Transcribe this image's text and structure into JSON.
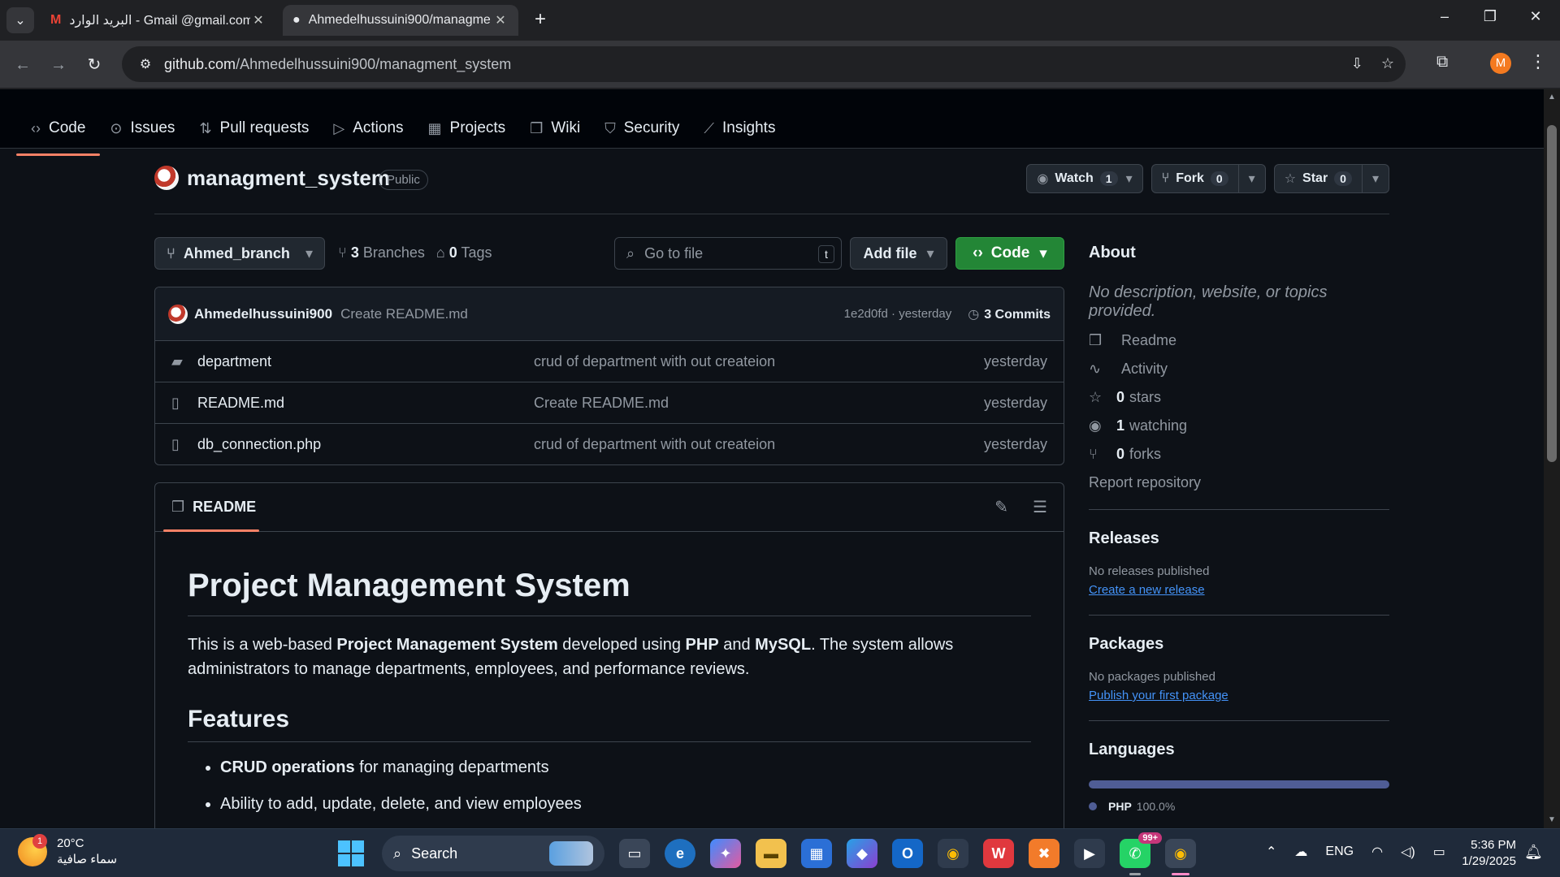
{
  "browser": {
    "tabs": [
      {
        "title": "البريد الوارد - Gmail @gmail.com",
        "active": false
      },
      {
        "title": "Ahmedelhussuini900/managme",
        "active": true
      }
    ],
    "url_host": "github.com",
    "url_path": "/Ahmedelhussuini900/managment_system",
    "profile_initial": "M"
  },
  "repo_nav": [
    {
      "label": "Code",
      "icon": "code-icon",
      "glyph": "‹›",
      "selected": true
    },
    {
      "label": "Issues",
      "icon": "issue-icon",
      "glyph": "⊙"
    },
    {
      "label": "Pull requests",
      "icon": "pull-request-icon",
      "glyph": "⇅"
    },
    {
      "label": "Actions",
      "icon": "play-icon",
      "glyph": "▷"
    },
    {
      "label": "Projects",
      "icon": "table-icon",
      "glyph": "▦"
    },
    {
      "label": "Wiki",
      "icon": "book-icon",
      "glyph": "❒"
    },
    {
      "label": "Security",
      "icon": "shield-icon",
      "glyph": "⛉"
    },
    {
      "label": "Insights",
      "icon": "graph-icon",
      "glyph": "⟋"
    }
  ],
  "repo": {
    "name": "managment_system",
    "visibility": "Public",
    "watch_label": "Watch",
    "watch_count": "1",
    "fork_label": "Fork",
    "fork_count": "0",
    "star_label": "Star",
    "star_count": "0"
  },
  "branch": {
    "current": "Ahmed_branch",
    "branches_count": "3",
    "branches_label": "Branches",
    "tags_count": "0",
    "tags_label": "Tags",
    "goto_placeholder": "Go to file",
    "goto_key": "t",
    "add_file": "Add file",
    "code_button": "Code"
  },
  "latest_commit": {
    "author": "Ahmedelhussuini900",
    "message": "Create README.md",
    "sha_time": "1e2d0fd · yesterday",
    "commits": "3 Commits"
  },
  "files": [
    {
      "type": "folder",
      "icon": "folder-icon",
      "name": "department",
      "message": "crud of department with out createion",
      "date": "yesterday"
    },
    {
      "type": "file",
      "icon": "file-icon",
      "name": "README.md",
      "message": "Create README.md",
      "date": "yesterday"
    },
    {
      "type": "file",
      "icon": "file-icon",
      "name": "db_connection.php",
      "message": "crud of department with out createion",
      "date": "yesterday"
    }
  ],
  "readme": {
    "tab_label": "README",
    "h1": "Project Management System",
    "para_parts": [
      "This is a web-based ",
      "Project Management System",
      " developed using ",
      "PHP",
      " and ",
      "MySQL",
      ". The system allows administrators to manage departments, employees, and performance reviews."
    ],
    "h2": "Features",
    "features": [
      {
        "bold": "CRUD operations",
        "rest": " for managing departments"
      },
      {
        "bold": "",
        "rest": "Ability to add, update, delete, and view employees"
      }
    ]
  },
  "about": {
    "heading": "About",
    "description": "No description, website, or topics provided.",
    "links": [
      {
        "icon": "book-icon",
        "glyph": "❒",
        "bold": "",
        "label": "Readme"
      },
      {
        "icon": "pulse-icon",
        "glyph": "∿",
        "bold": "",
        "label": "Activity"
      },
      {
        "icon": "star-icon",
        "glyph": "☆",
        "bold": "0",
        "label": "stars"
      },
      {
        "icon": "eye-icon",
        "glyph": "◉",
        "bold": "1",
        "label": "watching"
      },
      {
        "icon": "fork-icon",
        "glyph": "⑂",
        "bold": "0",
        "label": "forks"
      }
    ],
    "report": "Report repository"
  },
  "releases": {
    "heading": "Releases",
    "empty": "No releases published",
    "link": "Create a new release"
  },
  "packages": {
    "heading": "Packages",
    "empty": "No packages published",
    "link": "Publish your first package"
  },
  "languages": {
    "heading": "Languages",
    "items": [
      {
        "name": "PHP",
        "percent": "100.0%",
        "color": "#4f5d95"
      }
    ]
  },
  "taskbar": {
    "temp": "20°C",
    "weather_text": "سماء صافية",
    "weather_badge": "1",
    "search_label": "Search",
    "lang": "ENG",
    "time": "5:36 PM",
    "date": "1/29/2025",
    "whatsapp_badge": "99+"
  },
  "colors": {
    "accent_underline": "#f78166",
    "code_button": "#238636",
    "link": "#4493f8",
    "bg": "#0d1117"
  }
}
